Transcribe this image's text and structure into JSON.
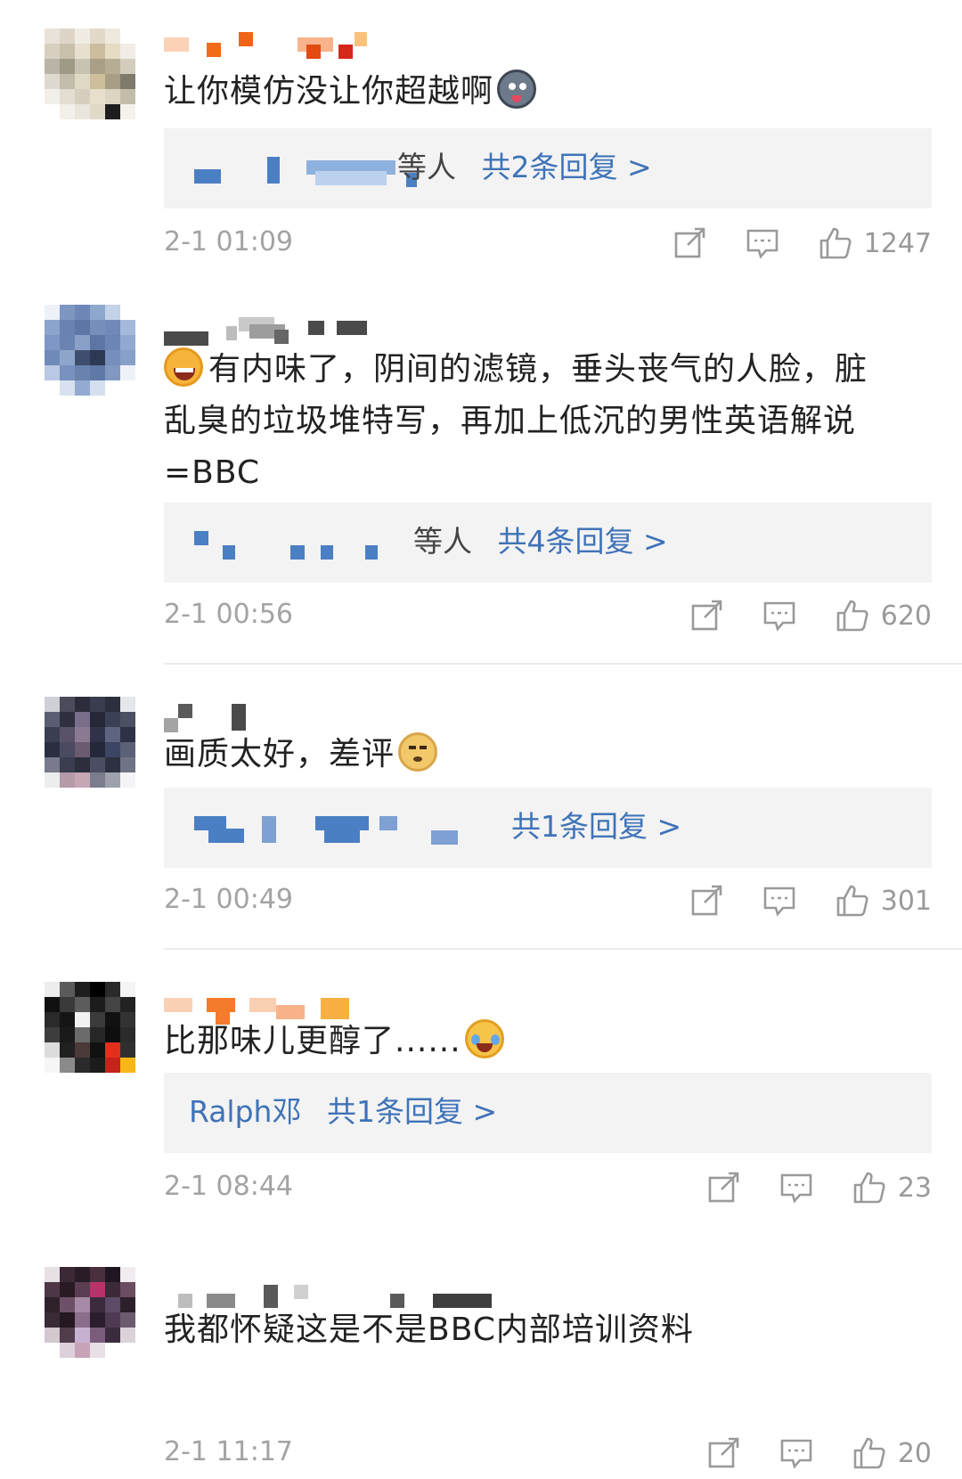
{
  "comments": [
    {
      "text": "让你模仿没让你超越啊",
      "reply_who": "等人",
      "reply_count": "共2条回复 >",
      "time": "2-1 01:09",
      "likes": "1247"
    },
    {
      "text": "有内味了，阴间的滤镜，垂头丧气的人脸，脏乱臭的垃圾堆特写，再加上低沉的男性英语解说=BBC",
      "reply_who": "等人",
      "reply_count": "共4条回复 >",
      "time": "2-1 00:56",
      "likes": "620"
    },
    {
      "text": "画质太好，差评",
      "reply_who": "",
      "reply_count": "共1条回复 >",
      "time": "2-1 00:49",
      "likes": "301"
    },
    {
      "text": "比那味儿更醇了......",
      "reply_who": "Ralph邓",
      "reply_count": "共1条回复 >",
      "time": "2-1 08:44",
      "likes": "23"
    },
    {
      "text": "我都怀疑这是不是BBC内部培训资料",
      "time": "2-1 11:17",
      "likes": "20"
    }
  ],
  "icons": {
    "share": "share-icon",
    "comment": "comment-icon",
    "like": "thumbs-up-icon"
  },
  "colors": {
    "link_blue": "#3f73b8",
    "meta_gray": "#a3a3a3",
    "reply_bg": "#f3f3f3"
  }
}
